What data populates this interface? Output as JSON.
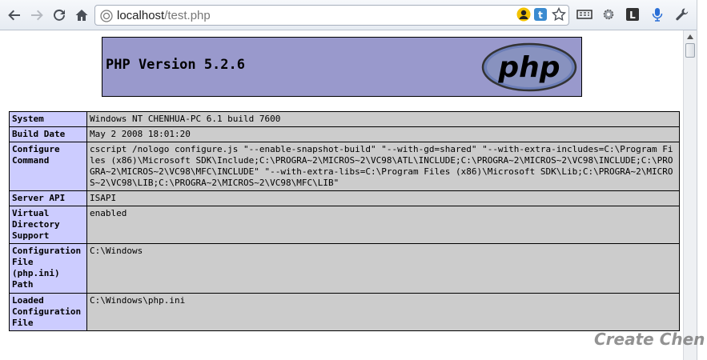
{
  "browser": {
    "url_host": "localhost",
    "url_path": "/test.php",
    "nav": [
      "back-icon",
      "forward-icon",
      "reload-icon",
      "home-icon"
    ],
    "extensions": [
      "user-extension-icon",
      "t-extension-icon",
      "star-icon",
      "reader-icon",
      "gear-icon",
      "l-extension-icon",
      "microphone-icon",
      "wrench-icon"
    ]
  },
  "page": {
    "title": "PHP Version 5.2.6",
    "logo_text": "php",
    "watermark": "Create Chen",
    "rows": [
      {
        "label": "System",
        "value": "Windows NT CHENHUA-PC 6.1 build 7600"
      },
      {
        "label": "Build Date",
        "value": "May 2 2008 18:01:20"
      },
      {
        "label": "Configure Command",
        "value": "cscript /nologo configure.js \"--enable-snapshot-build\" \"--with-gd=shared\" \"--with-extra-includes=C:\\Program Files (x86)\\Microsoft SDK\\Include;C:\\PROGRA~2\\MICROS~2\\VC98\\ATL\\INCLUDE;C:\\PROGRA~2\\MICROS~2\\VC98\\INCLUDE;C:\\PROGRA~2\\MICROS~2\\VC98\\MFC\\INCLUDE\" \"--with-extra-libs=C:\\Program Files (x86)\\Microsoft SDK\\Lib;C:\\PROGRA~2\\MICROS~2\\VC98\\LIB;C:\\PROGRA~2\\MICROS~2\\VC98\\MFC\\LIB\""
      },
      {
        "label": "Server API",
        "value": "ISAPI"
      },
      {
        "label": "Virtual Directory Support",
        "value": "enabled"
      },
      {
        "label": "Configuration File (php.ini) Path",
        "value": "C:\\Windows"
      },
      {
        "label": "Loaded Configuration File",
        "value": "C:\\Windows\\php.ini"
      }
    ]
  },
  "colors": {
    "header_bg": "#9999cc",
    "label_bg": "#ccccff",
    "value_bg": "#cccccc"
  }
}
